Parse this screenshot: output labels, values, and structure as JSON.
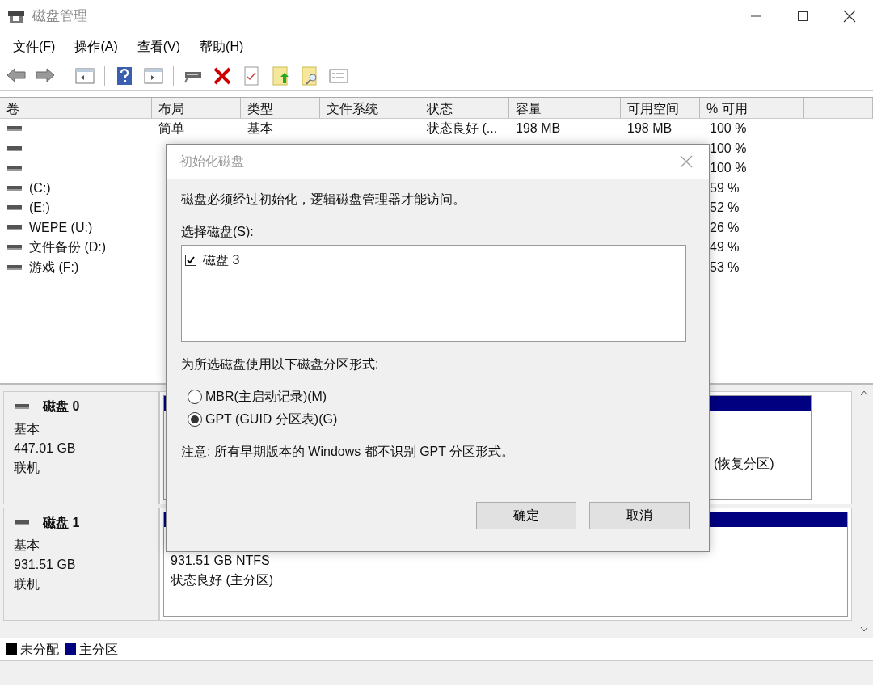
{
  "window": {
    "title": "磁盘管理"
  },
  "menu": [
    {
      "label": "文件(F)"
    },
    {
      "label": "操作(A)"
    },
    {
      "label": "查看(V)"
    },
    {
      "label": "帮助(H)"
    }
  ],
  "volume_table": {
    "columns": [
      "卷",
      "布局",
      "类型",
      "文件系统",
      "状态",
      "容量",
      "可用空间",
      "% 可用"
    ],
    "rows": [
      {
        "volume": "",
        "layout": "简单",
        "type": "基本",
        "file_system": "",
        "status": "状态良好 (...",
        "capacity": "198 MB",
        "free": "198 MB",
        "percent": "100 %"
      },
      {
        "volume": "",
        "percent": "100 %"
      },
      {
        "volume": "",
        "percent": "100 %"
      },
      {
        "volume": "(C:)",
        "percent": "59 %"
      },
      {
        "volume": "(E:)",
        "percent": "52 %"
      },
      {
        "volume": "WEPE (U:)",
        "percent": "26 %"
      },
      {
        "volume": "文件备份 (D:)",
        "percent": "49 %"
      },
      {
        "volume": "游戏 (F:)",
        "percent": "53 %"
      }
    ]
  },
  "disks": [
    {
      "name": "磁盘 0",
      "type": "基本",
      "size": "447.01 GB",
      "status": "联机",
      "partitions": [
        {
          "kind": "covered"
        },
        {
          "kind": "narrow",
          "lines": [
            "(恢复分区)"
          ]
        }
      ]
    },
    {
      "name": "磁盘 1",
      "type": "基本",
      "size": "931.51 GB",
      "status": "联机",
      "partitions": [
        {
          "kind": "wide",
          "lines": [
            "931.51 GB NTFS",
            "状态良好 (主分区)"
          ]
        }
      ]
    }
  ],
  "legend": [
    {
      "label": "未分配",
      "color": "#000000"
    },
    {
      "label": "主分区",
      "color": "#000080"
    }
  ],
  "dialog": {
    "title": "初始化磁盘",
    "message": "磁盘必须经过初始化，逻辑磁盘管理器才能访问。",
    "select_label": "选择磁盘(S):",
    "disks": [
      {
        "label": "磁盘 3",
        "checked": true
      }
    ],
    "style_label": "为所选磁盘使用以下磁盘分区形式:",
    "options": [
      {
        "label": "MBR(主启动记录)(M)",
        "selected": false
      },
      {
        "label": "GPT (GUID 分区表)(G)",
        "selected": true
      }
    ],
    "note": "注意: 所有早期版本的 Windows 都不识别 GPT 分区形式。",
    "buttons": [
      "确定",
      "取消"
    ]
  }
}
